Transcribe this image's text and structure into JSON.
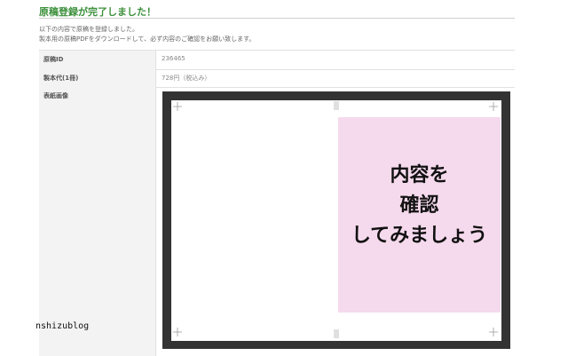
{
  "page": {
    "title": "原稿登録が完了しました！",
    "intro_line1": "以下の内容で原稿を登録しました。",
    "intro_line2": "製本用の原稿PDFをダウンロードして、必ず内容のご確認をお願い致します。"
  },
  "table": {
    "rows": [
      {
        "label": "原稿ID",
        "value": "236465"
      },
      {
        "label": "製本代(1冊)",
        "value": "728円（税込み）"
      },
      {
        "label": "表紙画像",
        "value": ""
      }
    ]
  },
  "cover": {
    "line1": "内容を",
    "line2": "確認",
    "line3": "してみましょう",
    "frame_color": "#333333",
    "pink_color": "#f5d9ec"
  },
  "watermark": "nshizublog"
}
